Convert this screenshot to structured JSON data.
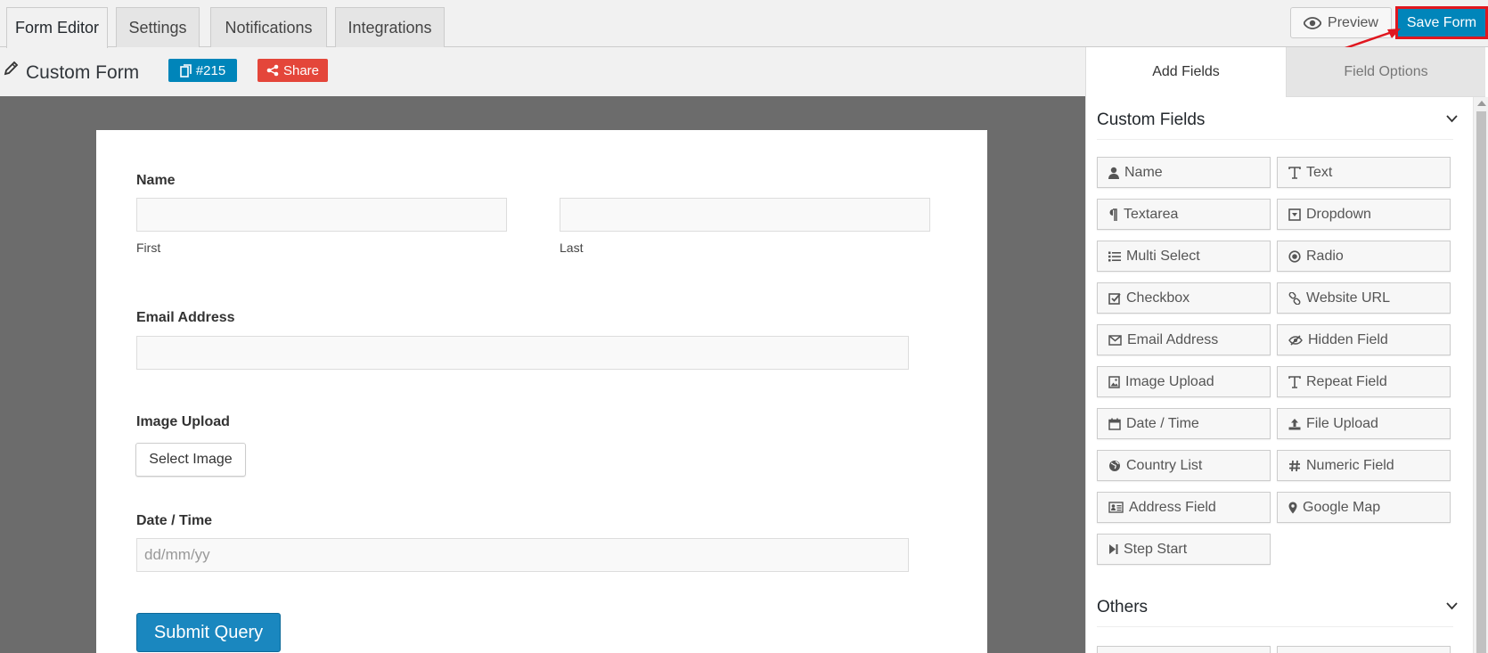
{
  "tabs": [
    {
      "label": "Form Editor"
    },
    {
      "label": "Settings"
    },
    {
      "label": "Notifications"
    },
    {
      "label": "Integrations"
    }
  ],
  "top_actions": {
    "preview_label": "Preview",
    "save_label": "Save Form"
  },
  "form_header": {
    "title": "Custom Form",
    "id_badge": "#215",
    "share_label": "Share"
  },
  "form": {
    "name_label": "Name",
    "first_sub": "First",
    "last_sub": "Last",
    "email_label": "Email Address",
    "image_label": "Image Upload",
    "select_image_label": "Select Image",
    "date_label": "Date / Time",
    "date_placeholder": "dd/mm/yy",
    "submit_label": "Submit Query"
  },
  "sidebar": {
    "tab_add": "Add Fields",
    "tab_options": "Field Options",
    "custom_title": "Custom Fields",
    "others_title": "Others",
    "fields": [
      {
        "label": "Name",
        "icon": "user-icon"
      },
      {
        "label": "Text",
        "icon": "text-icon"
      },
      {
        "label": "Textarea",
        "icon": "paragraph-icon"
      },
      {
        "label": "Dropdown",
        "icon": "dropdown-icon"
      },
      {
        "label": "Multi Select",
        "icon": "list-icon"
      },
      {
        "label": "Radio",
        "icon": "radio-icon"
      },
      {
        "label": "Checkbox",
        "icon": "checkbox-icon"
      },
      {
        "label": "Website URL",
        "icon": "link-icon"
      },
      {
        "label": "Email Address",
        "icon": "envelope-icon"
      },
      {
        "label": "Hidden Field",
        "icon": "eye-slash-icon"
      },
      {
        "label": "Image Upload",
        "icon": "image-icon"
      },
      {
        "label": "Repeat Field",
        "icon": "text-icon"
      },
      {
        "label": "Date / Time",
        "icon": "calendar-icon"
      },
      {
        "label": "File Upload",
        "icon": "upload-icon"
      },
      {
        "label": "Country List",
        "icon": "globe-icon"
      },
      {
        "label": "Numeric Field",
        "icon": "hash-icon"
      },
      {
        "label": "Address Field",
        "icon": "address-card-icon"
      },
      {
        "label": "Google Map",
        "icon": "map-marker-icon"
      },
      {
        "label": "Step Start",
        "icon": "step-icon"
      }
    ]
  },
  "colors": {
    "primary": "#0085ba",
    "share": "#e4463a",
    "highlight": "#e0171f"
  }
}
